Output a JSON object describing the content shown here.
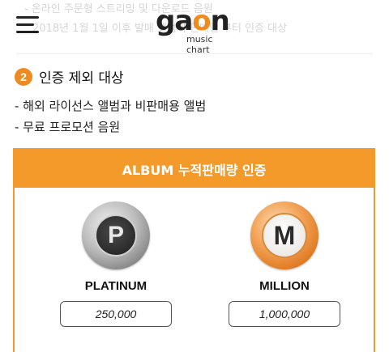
{
  "background_text": {
    "line1": "- 온라인 주문형 스트리밍 및 다운로드 음원",
    "line2": "2018년 1월 1일 이후 발매 앨범의 판매일 부터 인증 대상"
  },
  "header": {
    "logo_word_prefix": "ga",
    "logo_word_o": "o",
    "logo_word_suffix": "n",
    "logo_subtitle": "music chart",
    "menu_icon": "hamburger-menu-icon"
  },
  "section": {
    "number": "2",
    "title": "인증 제외 대상",
    "bullets": [
      "- 해외 라이선스 앨범과 비판매용 앨범",
      "- 무료 프로모션 음원"
    ]
  },
  "certification": {
    "header": "ALBUM 누적판매량 인증",
    "items": [
      {
        "label": "PLATINUM",
        "value": "250,000",
        "medal_letter": "P",
        "medal_color": "#9e9e9e"
      },
      {
        "label": "MILLION",
        "value": "1,000,000",
        "medal_letter": "M",
        "medal_color": "#e8852a"
      }
    ]
  },
  "colors": {
    "accent": "#f39a2b"
  }
}
